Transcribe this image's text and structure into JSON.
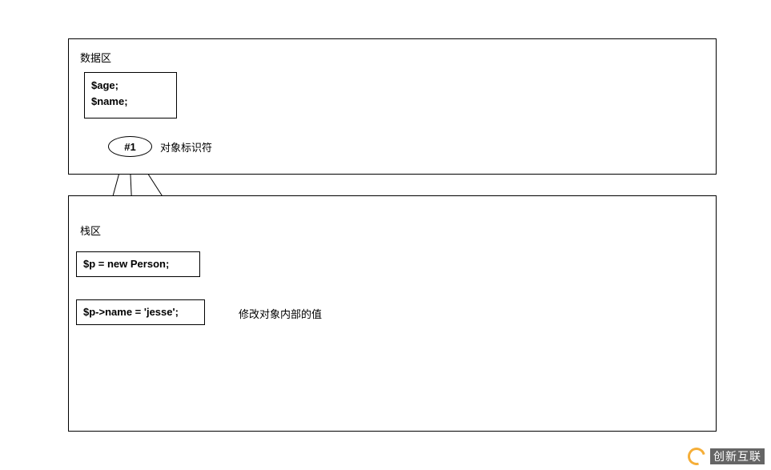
{
  "top_region": {
    "label": "数据区",
    "data_box": {
      "line1": "$age;",
      "line2": "$name;"
    },
    "identifier": {
      "text": "#1",
      "annotation": "对象标识符"
    }
  },
  "bottom_region": {
    "label": "栈区",
    "stmt_box1": "$p = new Person;",
    "stmt_box2": "$p->name = 'jesse';",
    "stmt_box2_annotation": "修改对象内部的值"
  },
  "watermark": "创新互联"
}
